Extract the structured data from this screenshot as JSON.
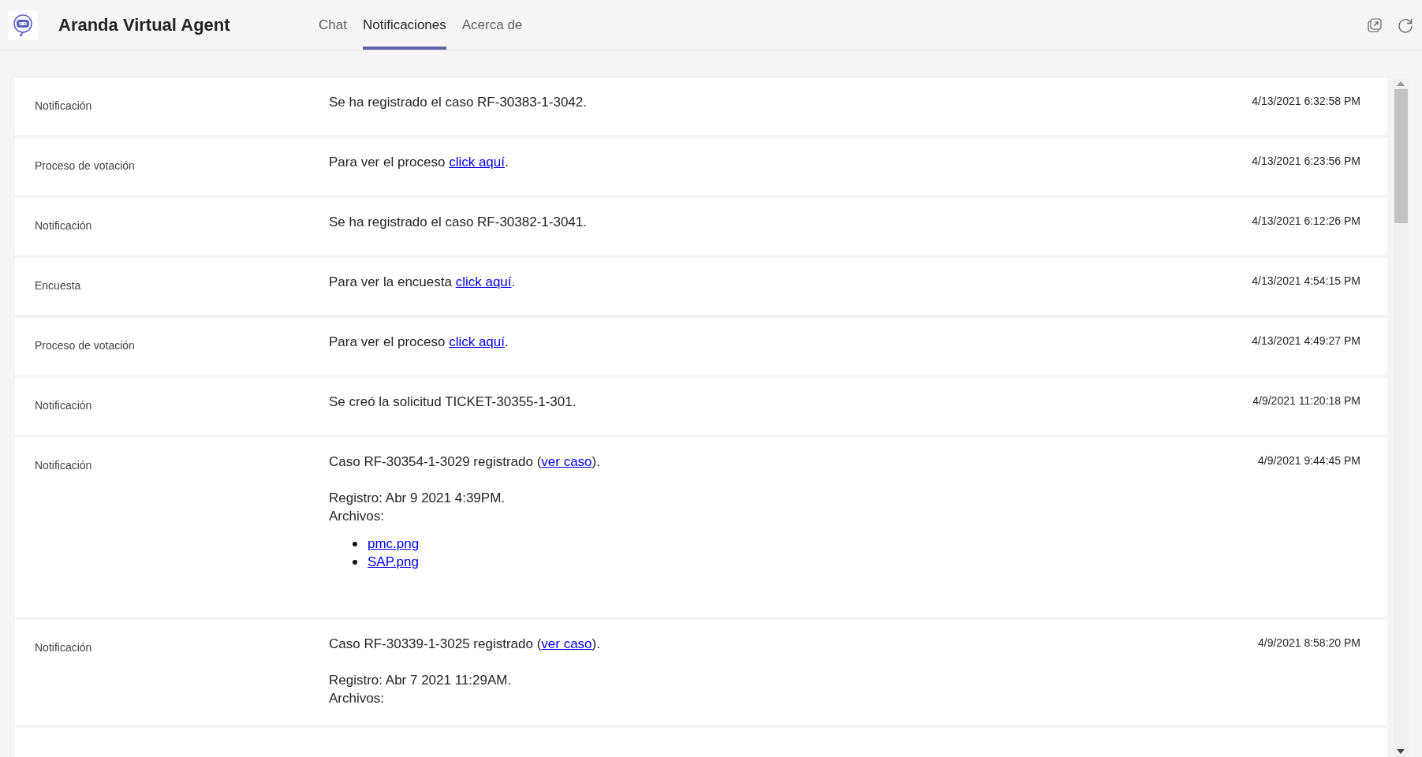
{
  "app": {
    "title": "Aranda Virtual Agent"
  },
  "tabs": [
    {
      "label": "Chat",
      "selected": false
    },
    {
      "label": "Notificaciones",
      "selected": true
    },
    {
      "label": "Acerca de",
      "selected": false
    }
  ],
  "notifications": [
    {
      "category": "Notificación",
      "message": [
        {
          "kind": "text",
          "text": "Se ha registrado el caso RF-30383-1-3042."
        }
      ],
      "time": "4/13/2021 6:32:58 PM"
    },
    {
      "category": "Proceso de votación",
      "message": [
        {
          "kind": "text",
          "text": "Para ver el proceso "
        },
        {
          "kind": "link",
          "text": "click aquí"
        },
        {
          "kind": "text",
          "text": "."
        }
      ],
      "time": "4/13/2021 6:23:56 PM"
    },
    {
      "category": "Notificación",
      "message": [
        {
          "kind": "text",
          "text": "Se ha registrado el caso RF-30382-1-3041."
        }
      ],
      "time": "4/13/2021 6:12:26 PM"
    },
    {
      "category": "Encuesta",
      "message": [
        {
          "kind": "text",
          "text": "Para ver la encuesta "
        },
        {
          "kind": "link",
          "text": "click aquí"
        },
        {
          "kind": "text",
          "text": "."
        }
      ],
      "time": "4/13/2021 4:54:15 PM"
    },
    {
      "category": "Proceso de votación",
      "message": [
        {
          "kind": "text",
          "text": "Para ver el proceso "
        },
        {
          "kind": "link",
          "text": "click aquí"
        },
        {
          "kind": "text",
          "text": "."
        }
      ],
      "time": "4/13/2021 4:49:27 PM"
    },
    {
      "category": "Notificación",
      "message": [
        {
          "kind": "text",
          "text": "Se creó la solicitud TICKET-30355-1-301."
        }
      ],
      "time": "4/9/2021 11:20:18 PM"
    },
    {
      "category": "Notificación",
      "message": [
        {
          "kind": "text",
          "text": "Caso RF-30354-1-3029 registrado ("
        },
        {
          "kind": "link",
          "text": "ver caso"
        },
        {
          "kind": "text",
          "text": ")."
        }
      ],
      "details": [
        "Registro: Abr 9 2021 4:39PM.",
        "Archivos:"
      ],
      "files": [
        "pmc.png",
        "SAP.png"
      ],
      "time": "4/9/2021 9:44:45 PM"
    },
    {
      "category": "Notificación",
      "message": [
        {
          "kind": "text",
          "text": "Caso RF-30339-1-3025 registrado ("
        },
        {
          "kind": "link",
          "text": "ver caso"
        },
        {
          "kind": "text",
          "text": ")."
        }
      ],
      "details": [
        "Registro: Abr 7 2021 11:29AM.",
        "Archivos:"
      ],
      "time": "4/9/2021 8:58:20 PM"
    }
  ]
}
